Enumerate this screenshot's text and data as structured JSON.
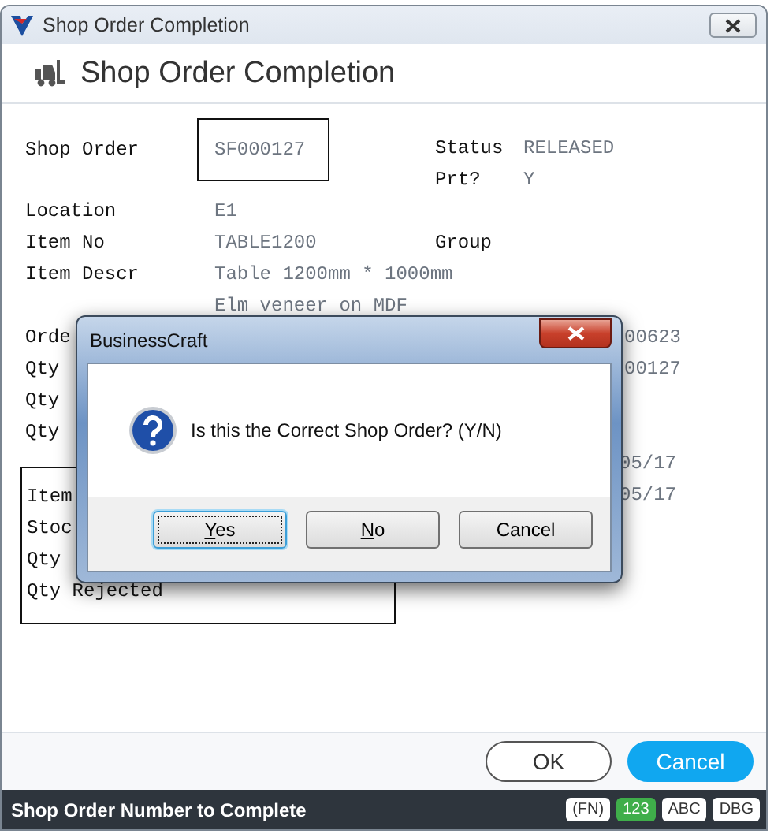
{
  "window": {
    "title": "Shop Order Completion"
  },
  "header": {
    "title": "Shop Order Completion"
  },
  "shop_order": {
    "label": "Shop Order",
    "value": "SF000127"
  },
  "status": [
    {
      "label": "Status",
      "value": "RELEASED"
    },
    {
      "label": "Prt?",
      "value": "Y"
    }
  ],
  "rows": [
    {
      "label": "Location",
      "value": "E1"
    },
    {
      "label": "Item No",
      "value": "TABLE1200",
      "label_2": "Group"
    },
    {
      "label": "Item Descr",
      "value": "Table 1200mm * 1000mm"
    },
    {
      "value": "Elm veneer on MDF"
    },
    {
      "label": "Orde",
      "value_2": "00623"
    },
    {
      "label": "Qty",
      "value_2": "00127"
    },
    {
      "label": "Qty"
    },
    {
      "label": "Qty"
    }
  ],
  "lower": {
    "values": [
      "05/17",
      "05/17"
    ],
    "panel_rows": [
      "Item",
      "Stoc",
      "Qty",
      "Qty Rejected"
    ]
  },
  "buttons": [
    {
      "label": "OK",
      "kind": "outline"
    },
    {
      "label": "Cancel",
      "kind": "primary"
    }
  ],
  "status_bar": {
    "text": "Shop Order Number to Complete",
    "badges": [
      {
        "label": "(FN)",
        "on": false
      },
      {
        "label": "123",
        "on": true
      },
      {
        "label": "ABC",
        "on": false
      },
      {
        "label": "DBG",
        "on": false
      }
    ]
  },
  "dialog": {
    "title": "BusinessCraft",
    "message": "Is this the Correct Shop Order? (Y/N)",
    "buttons": [
      {
        "label": "Yes",
        "mnemonic": true,
        "focused": true
      },
      {
        "label": "No",
        "mnemonic": true,
        "focused": false
      },
      {
        "label": "Cancel",
        "mnemonic": false,
        "focused": false
      }
    ]
  }
}
